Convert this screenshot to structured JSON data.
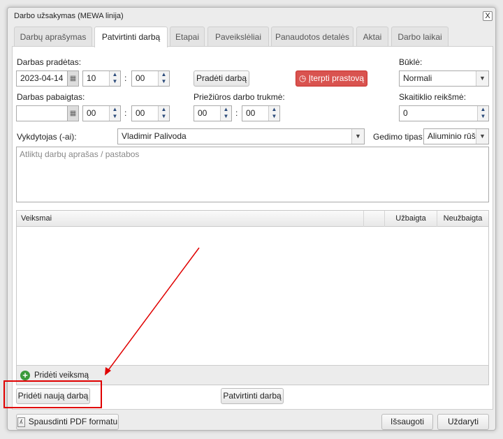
{
  "dialog": {
    "title": "Darbo užsakymas (MEWA linija)",
    "close": "X"
  },
  "tabs": [
    {
      "label": "Darbų aprašymas"
    },
    {
      "label": "Patvirtinti darbą"
    },
    {
      "label": "Etapai"
    },
    {
      "label": "Paveikslėliai"
    },
    {
      "label": "Panaudotos detalės"
    },
    {
      "label": "Aktai"
    },
    {
      "label": "Darbo laikai"
    }
  ],
  "form": {
    "started_label": "Darbas pradėtas:",
    "started_date": "2023-04-14",
    "started_hour": "10",
    "started_min": "00",
    "finished_label": "Darbas pabaigtas:",
    "finished_date": "",
    "finished_hour": "00",
    "finished_min": "00",
    "colon": ":",
    "start_work_button": "Pradėti darbą",
    "insert_downtime_button": "Įterpti prastovą",
    "maint_label": "Priežiūros darbo trukmė:",
    "maint_hour": "00",
    "maint_min": "00",
    "status_label": "Būklė:",
    "status_value": "Normali",
    "counter_label": "Skaitiklio reikšmė:",
    "counter_value": "0",
    "executor_label": "Vykdytojas (-ai):",
    "executor_value": "Vladimir Palivoda",
    "fault_label": "Gedimo tipas:",
    "fault_value": "Aliuminio rūšia",
    "notes_placeholder": "Atliktų darbų aprašas / pastabos"
  },
  "table": {
    "columns": [
      "Veiksmai",
      "",
      "Užbaigta",
      "Neužbaigta"
    ],
    "add_action": "Pridėti veiksmą"
  },
  "buttons": {
    "add_new_work": "Pridėti naują darbą",
    "confirm_work": "Patvirtinti darbą",
    "print_pdf": "Spausdinti PDF formatu",
    "save": "Išsaugoti",
    "close": "Uždaryti"
  },
  "colors": {
    "danger": "#d9534f",
    "annotation": "#e00000",
    "add_icon": "#3a9a3a"
  }
}
